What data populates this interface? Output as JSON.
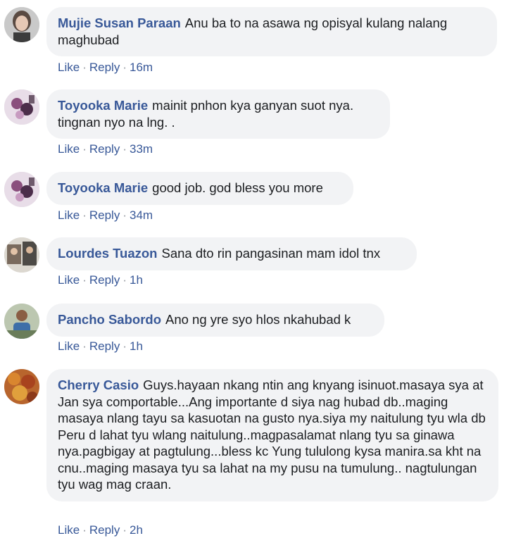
{
  "comments": [
    {
      "author": "Mujie Susan Paraan",
      "text": "Anu ba to na asawa ng opisyal kulang nalang maghubad",
      "like": "Like",
      "reply": "Reply",
      "time": "16m",
      "avatar_icon": "woman-portrait-icon"
    },
    {
      "author": "Toyooka Marie",
      "text": "mainit pnhon kya ganyan suot nya. tingnan nyo na lng. .",
      "like": "Like",
      "reply": "Reply",
      "time": "33m",
      "avatar_icon": "floral-portrait-icon"
    },
    {
      "author": "Toyooka Marie",
      "text": "good job. god bless you more",
      "like": "Like",
      "reply": "Reply",
      "time": "34m",
      "avatar_icon": "floral-portrait-icon"
    },
    {
      "author": "Lourdes Tuazon",
      "text": "Sana dto rin pangasinan mam idol tnx",
      "like": "Like",
      "reply": "Reply",
      "time": "1h",
      "avatar_icon": "group-photo-icon"
    },
    {
      "author": "Pancho Sabordo",
      "text": "Ano ng yre syo hlos nkahubad k",
      "like": "Like",
      "reply": "Reply",
      "time": "1h",
      "avatar_icon": "man-portrait-icon"
    },
    {
      "author": "Cherry Casio",
      "text": "Guys.hayaan nkang ntin ang knyang isinuot.masaya sya at Jan sya comportable...Ang importante d siya nag hubad db..maging masaya nlang tayu sa kasuotan na gusto nya.siya my naitulung tyu wla db Peru d lahat tyu wlang naitulung..magpasalamat nlang tyu sa ginawa nya.pagbigay at pagtulung...bless kc Yung tululong kysa manira.sa kht na cnu..maging masaya tyu sa lahat na my pusu na tumulung.. nagtulungan tyu wag mag craan.",
      "like": "Like",
      "reply": "Reply",
      "time": "2h",
      "avatar_icon": "autumn-leaves-icon"
    }
  ],
  "separator": "·",
  "colors": {
    "link": "#385898",
    "bubble": "#f2f3f5",
    "text": "#1c1e21",
    "meta": "#90949c"
  }
}
